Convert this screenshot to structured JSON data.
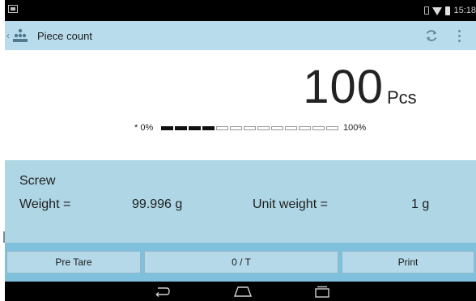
{
  "status_bar": {
    "time": "15:18"
  },
  "app_bar": {
    "title": "Piece count",
    "back_glyph": "‹",
    "logo_icon": "people-count-icon",
    "refresh_icon": "refresh-icon",
    "menu_icon": "overflow-menu-icon"
  },
  "display": {
    "value": "100",
    "unit": "Pcs",
    "bar_min_label": "* 0%",
    "bar_max_label": "100%",
    "bar_segments_total": 13,
    "bar_segments_filled": 4
  },
  "info": {
    "item_name": "Screw",
    "weight_label": "Weight =",
    "weight_value": "99.996 g",
    "unit_weight_label": "Unit weight =",
    "unit_weight_value": "1 g"
  },
  "keys": {
    "pre_tare": "Pre Tare",
    "zero_tare": "0 / T",
    "print": "Print"
  },
  "colors": {
    "app_bar": "#b8dcec",
    "info_panel": "#aed6e5",
    "key_strip": "#7fc0dc",
    "key": "#b5d9e8"
  }
}
